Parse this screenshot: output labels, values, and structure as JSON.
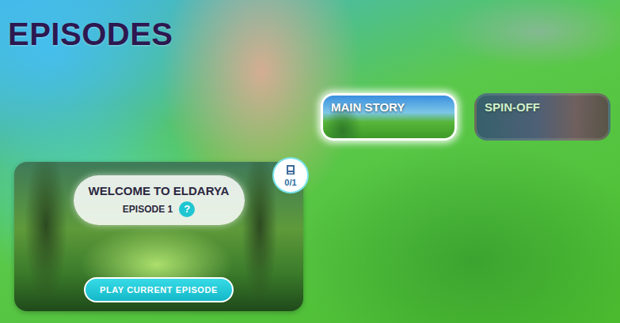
{
  "header": {
    "title": "EPISODES"
  },
  "tabs": [
    {
      "label": "MAIN STORY",
      "selected": true
    },
    {
      "label": "SPIN-OFF",
      "selected": false
    }
  ],
  "episode": {
    "title": "WELCOME TO ELDARYA",
    "number": "EPISODE 1",
    "help": "?",
    "progress": "0/1",
    "button": "PLAY CURRENT EPISODE"
  }
}
